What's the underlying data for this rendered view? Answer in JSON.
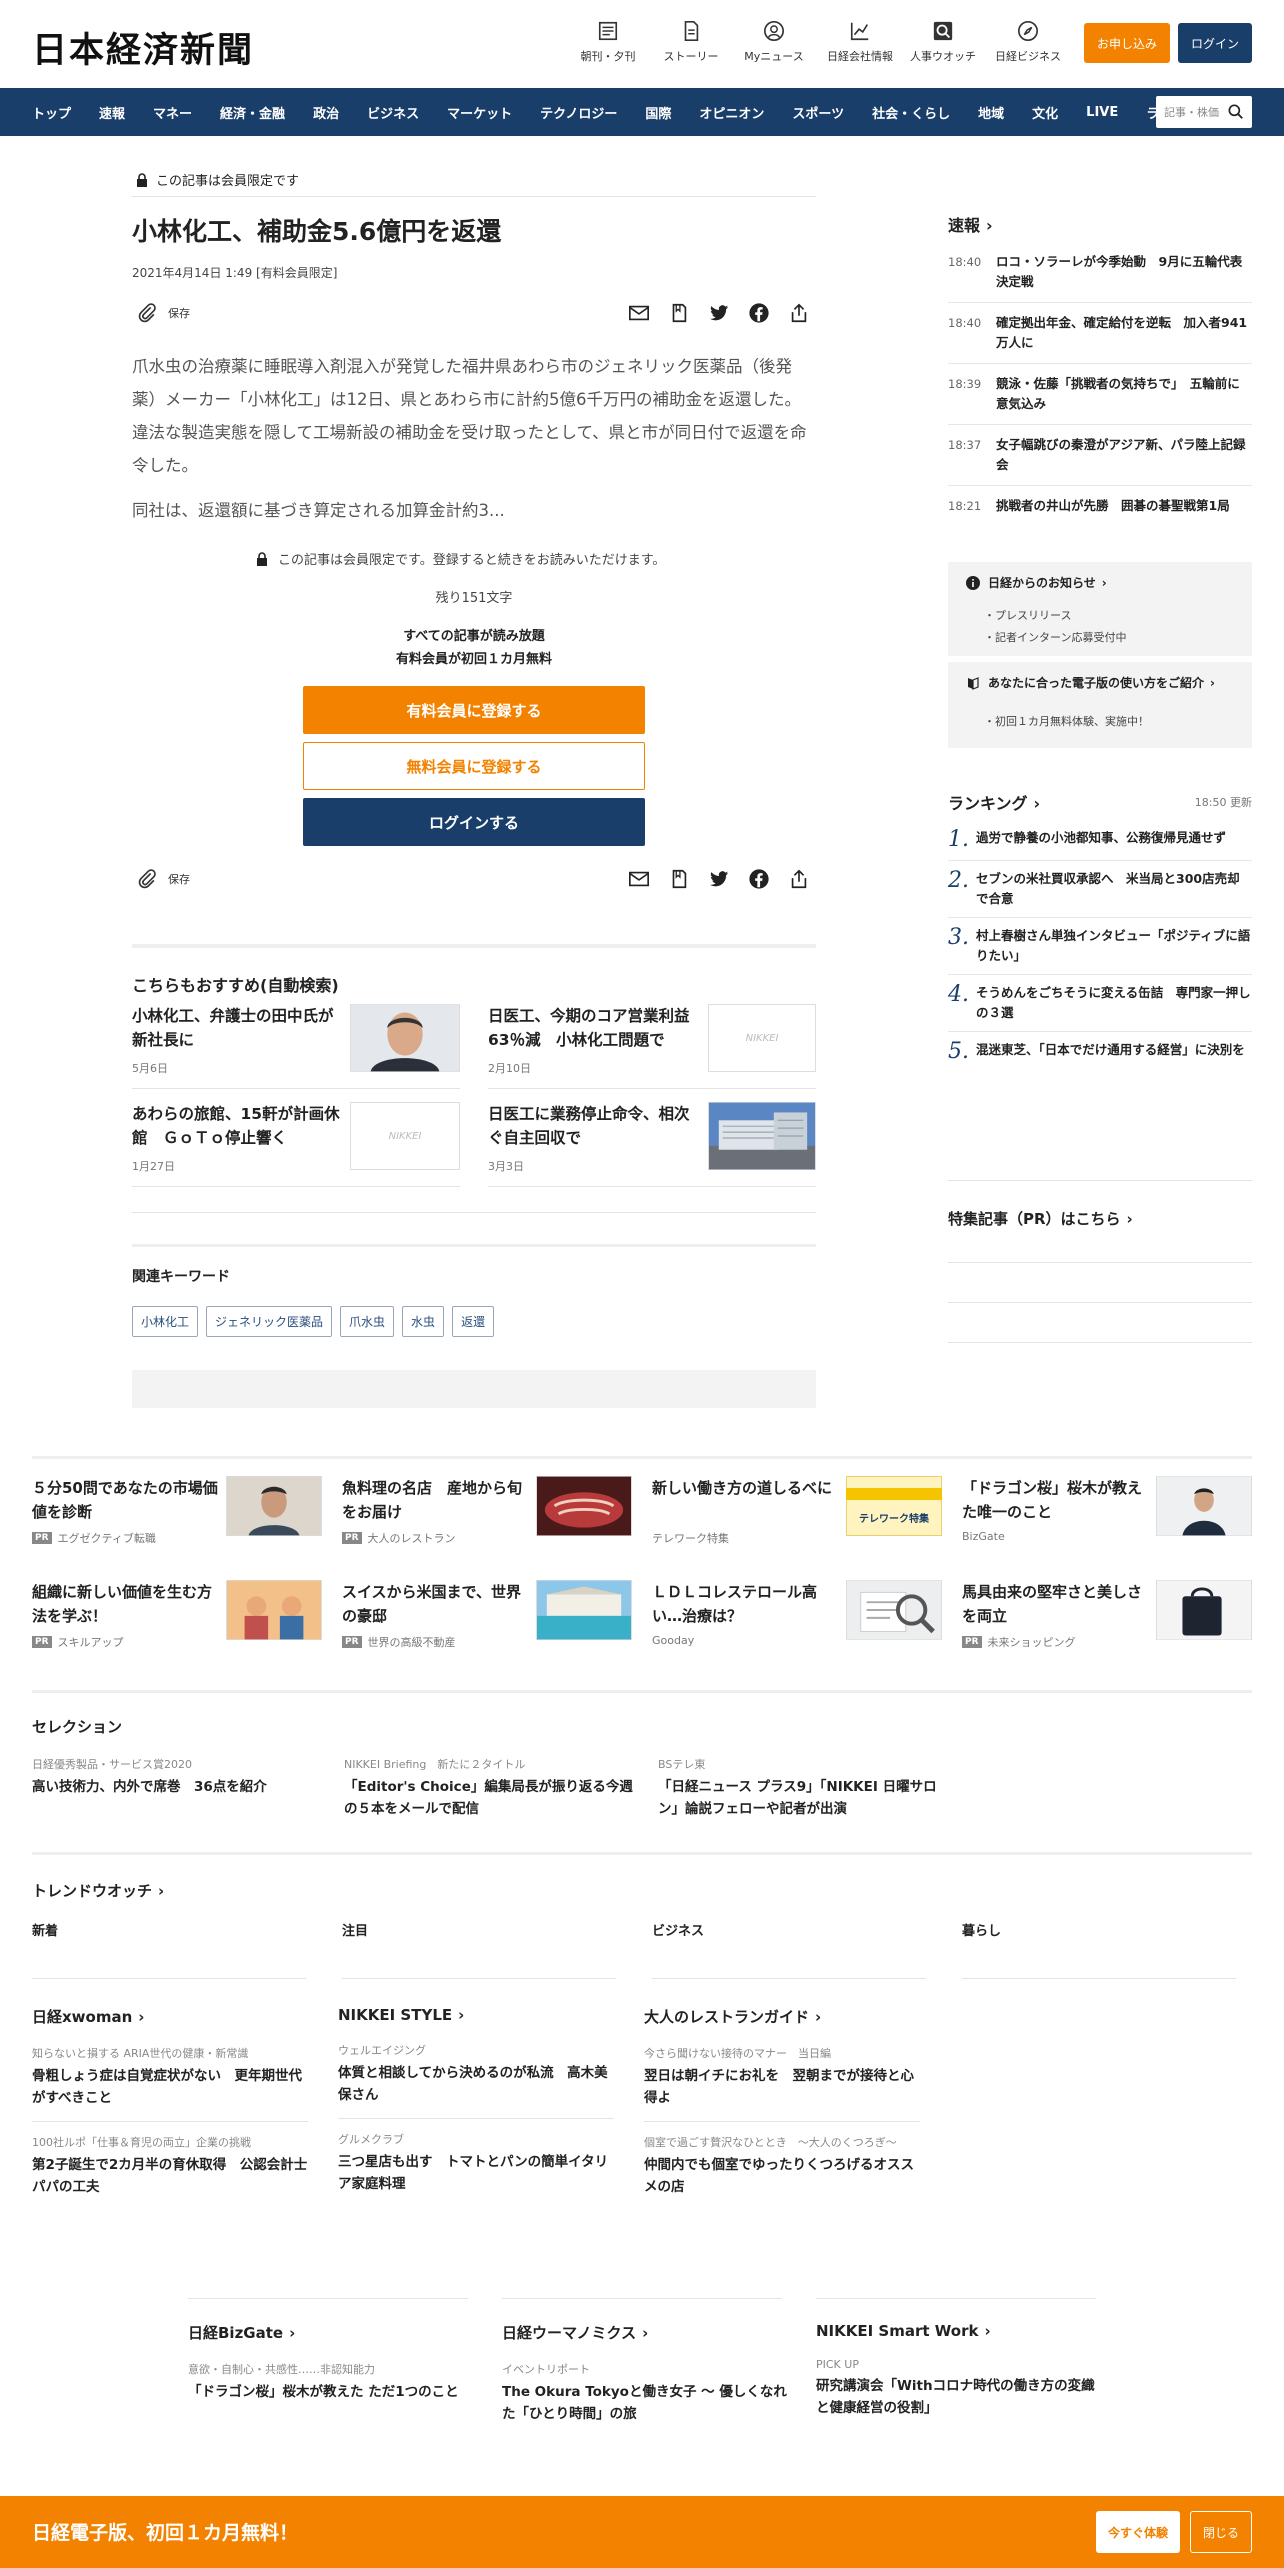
{
  "header": {
    "logo": "日本経済新聞",
    "nav": [
      {
        "label": "朝刊・夕刊",
        "icon": "newspaper-icon"
      },
      {
        "label": "ストーリー",
        "icon": "story-icon"
      },
      {
        "label": "Myニュース",
        "icon": "user-icon"
      },
      {
        "label": "日経会社情報",
        "icon": "chart-icon"
      },
      {
        "label": "人事ウオッチ",
        "icon": "search-icon"
      },
      {
        "label": "日経ビジネス",
        "icon": "compass-icon"
      }
    ],
    "subscribe": "お申し込み",
    "login": "ログイン"
  },
  "navbar": {
    "items": [
      "トップ",
      "速報",
      "マネー",
      "経済・金融",
      "政治",
      "ビジネス",
      "マーケット",
      "テクノロジー",
      "国際",
      "オピニオン",
      "スポーツ",
      "社会・くらし",
      "地域",
      "文化",
      "LIVE",
      "ライフ"
    ],
    "search_placeholder": "記事・株価"
  },
  "article": {
    "member_label": "この記事は会員限定です",
    "title": "小林化工、補助金5.6億円を返還",
    "date": "2021年4月14日 1:49 [有料会員限定]",
    "save": "保存",
    "body1": "爪水虫の治療薬に睡眠導入剤混入が発覚した福井県あわら市のジェネリック医薬品（後発薬）メーカー「小林化工」は12日、県とあわら市に計約5億6千万円の補助金を返還した。違法な製造実態を隠して工場新設の補助金を受け取ったとして、県と市が同日付で返還を命令した。",
    "body2": "同社は、返還額に基づき算定される加算金計約3...",
    "paywall_notice": "この記事は会員限定です。登録すると続きをお読みいただけます。",
    "remaining": "残り151文字",
    "promo1": "すべての記事が読み放題",
    "promo2": "有料会員が初回１カ月無料",
    "btn_paid": "有料会員に登録する",
    "btn_free": "無料会員に登録する",
    "btn_login": "ログインする",
    "save2": "保存"
  },
  "recommend": {
    "title": "こちらもおすすめ(自動検索)",
    "items": [
      {
        "headline": "小林化工、弁護士の田中氏が新社長に",
        "date": "5月6日"
      },
      {
        "headline": "日医工、今期のコア営業利益63％減　小林化工問題で",
        "date": "2月10日"
      },
      {
        "headline": "あわらの旅館、15軒が計画休館　ＧｏＴｏ停止響く",
        "date": "1月27日"
      },
      {
        "headline": "日医工に業務停止命令、相次ぐ自主回収で",
        "date": "3月3日"
      }
    ],
    "placeholder": "NIKKEI"
  },
  "keywords": {
    "title": "関連キーワード",
    "items": [
      "小林化工",
      "ジェネリック医薬品",
      "爪水虫",
      "水虫",
      "返還"
    ]
  },
  "sidebar": {
    "breaking_title": "速報",
    "breaking": [
      {
        "time": "18:40",
        "headline": "ロコ・ソラーレが今季始動　9月に五輪代表決定戦"
      },
      {
        "time": "18:40",
        "headline": "確定拠出年金、確定給付を逆転　加入者941万人に"
      },
      {
        "time": "18:39",
        "headline": "競泳・佐藤「挑戦者の気持ちで」　五輪前に意気込み"
      },
      {
        "time": "18:37",
        "headline": "女子幅跳びの秦澄がアジア新、パラ陸上記録会"
      },
      {
        "time": "18:21",
        "headline": "挑戦者の井山が先勝　囲碁の碁聖戦第1局"
      }
    ],
    "notice_title": "日経からのお知らせ",
    "notice_items": [
      "プレスリリース",
      "記者インターン応募受付中"
    ],
    "guide_title": "あなたに合った電子版の使い方をご紹介",
    "guide_items": [
      "初回１カ月無料体験、実施中！"
    ],
    "ranking_title": "ランキング",
    "ranking_update": "18:50  更新",
    "ranking": [
      "過労で静養の小池都知事、公務復帰見通せず",
      "セブンの米社買収承認へ　米当局と300店売却で合意",
      "村上春樹さん単独インタビュー「ポジティブに語りたい」",
      "そうめんをごちそうに変える缶詰　専門家一押しの３選",
      "混迷東芝、「日本でだけ通用する経営」に決別を"
    ],
    "feature_title": "特集記事（PR）はこちら"
  },
  "promos": [
    {
      "headline": "５分50問であなたの市場価値を診断",
      "source": "エグゼクティブ転職",
      "pr": true
    },
    {
      "headline": "魚料理の名店　産地から旬をお届け",
      "source": "大人のレストラン",
      "pr": true
    },
    {
      "headline": "新しい働き方の道しるべに",
      "source": "テレワーク特集",
      "pr": false
    },
    {
      "headline": "「ドラゴン桜」桜木が教えた唯一のこと",
      "source": "BizGate",
      "pr": false
    },
    {
      "headline": "組織に新しい価値を生む方法を学ぶ！",
      "source": "スキルアップ",
      "pr": true
    },
    {
      "headline": "スイスから米国まで、世界の豪邸",
      "source": "世界の高級不動産",
      "pr": true
    },
    {
      "headline": "ＬＤＬコレステロール高い…治療は？",
      "source": "Gooday",
      "pr": false
    },
    {
      "headline": "馬具由来の堅牢さと美しさを両立",
      "source": "未来ショッピング",
      "pr": true
    }
  ],
  "pr_badge": "PR",
  "telework_thumb": "テレワーク特集",
  "selection": {
    "title": "セレクション",
    "items": [
      {
        "cat": "日経優秀製品・サービス賞2020",
        "headline": "高い技術力、内外で席巻　36点を紹介"
      },
      {
        "cat": "NIKKEI Briefing　新たに２タイトル",
        "headline": "「Editor's Choice」編集局長が振り返る今週の５本をメールで配信"
      },
      {
        "cat": "BSテレ東",
        "headline": "「日経ニュース プラス9」「NIKKEI 日曜サロン」論説フェローや記者が出演"
      }
    ]
  },
  "trend": {
    "title": "トレンドウオッチ",
    "tabs": [
      "新着",
      "注目",
      "ビジネス",
      "暮らし"
    ]
  },
  "media": [
    {
      "title": "日経xwoman",
      "items": [
        {
          "cat": "知らないと損する ARIA世代の健康・新常識",
          "headline": "骨粗しょう症は自覚症状がない　更年期世代がすべきこと"
        },
        {
          "cat": "100社ルポ「仕事＆育児の両立」企業の挑戦",
          "headline": "第2子誕生で2カ月半の育休取得　公認会計士パパの工夫"
        }
      ]
    },
    {
      "title": "NIKKEI STYLE",
      "items": [
        {
          "cat": "ウェルエイジング",
          "headline": "体質と相談してから決めるのが私流　高木美保さん"
        },
        {
          "cat": "グルメクラブ",
          "headline": "三つ星店も出す　トマトとパンの簡単イタリア家庭料理"
        }
      ]
    },
    {
      "title": "大人のレストランガイド",
      "items": [
        {
          "cat": "今さら聞けない接待のマナー　当日編",
          "headline": "翌日は朝イチにお礼を　翌朝までが接待と心得よ"
        },
        {
          "cat": "個室で過ごす贅沢なひととき　～大人のくつろぎ～",
          "headline": "仲間内でも個室でゆったりくつろげるオススメの店"
        }
      ]
    }
  ],
  "media2": [
    {
      "title": "日経BizGate",
      "cat": "意欲・自制心・共感性……非認知能力",
      "headline": "「ドラゴン桜」桜木が教えた ただ1つのこと"
    },
    {
      "title": "日経ウーマノミクス",
      "cat": "イベントリポート",
      "headline": "The Okura Tokyoと働き女子 ～ 優しくなれた「ひとり時間」の旅"
    },
    {
      "title": "NIKKEI Smart Work",
      "cat": "PICK UP",
      "headline": "研究講演会「Withコロナ時代の働き方の変織と健康経営の役割」"
    }
  ],
  "footer": {
    "message": "日経電子版、初回１カ月無料！",
    "try": "今すぐ体験",
    "close": "閉じる"
  },
  "colors": {
    "navy": "#1a3e6a",
    "orange": "#f38200"
  }
}
